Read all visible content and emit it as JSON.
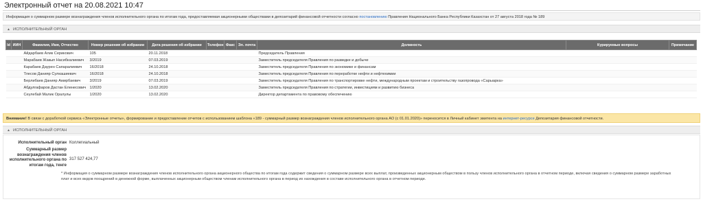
{
  "page": {
    "title": "Электронный отчет на 20.08.2021 10:47"
  },
  "info_bar": {
    "text_before": "Информация о суммарном размере вознаграждения членов исполнительного органа по итогам года, предоставляемая акционерными обществами в депозитарий финансовой отчетности согласно ",
    "link_text": "постановлению",
    "text_after": " Правления Национального Банка Республики Казахстан от 27 августа 2018 года № 189"
  },
  "section1": {
    "icon": "triangle-up-icon",
    "title": "ИСПОЛНИТЕЛЬНЫЙ ОРГАН"
  },
  "table": {
    "columns": [
      "Id",
      "ИИН",
      "Фамилия, Имя, Отчество",
      "Номер решения об избрании",
      "Дата решения об избрании",
      "Телефон",
      "Факс",
      "Эл. почта",
      "Должность",
      "Курируемые вопросы",
      "Примечание"
    ],
    "rows": [
      [
        "",
        "",
        "Айдарбаев Алик Серикович",
        "105",
        "20.11.2018",
        "",
        "",
        "",
        "Председатель Правления",
        "",
        ""
      ],
      [
        "",
        "",
        "Марабаев Жакып Насибкалиевич",
        "3/2019",
        "07.03.2019",
        "",
        "",
        "",
        "Заместитель председателя Правления по разведке и добыче",
        "",
        ""
      ],
      [
        "",
        "",
        "Карабаев Даурен Сапаралиевич",
        "16/2018",
        "24.10.2018",
        "",
        "",
        "",
        "Заместитель председателя Правления по экономике и финансам",
        "",
        ""
      ],
      [
        "",
        "",
        "Тлесов Данияр Сулкашиевич",
        "16/2018",
        "24.10.2018",
        "",
        "",
        "",
        "Заместитель председателя Правления по переработке нефти и нефтехимии",
        "",
        ""
      ],
      [
        "",
        "",
        "Берлибаев Данияр Амирбаевич",
        "3/2019",
        "07.03.2019",
        "",
        "",
        "",
        "Заместитель председателя Правления по транспортировке нефти, международным проектам и строительству газопровода «Сарыарка»",
        "",
        ""
      ],
      [
        "",
        "",
        "Абдулгафаров Дастан Еленесович",
        "1/2020",
        "13.02.2020",
        "",
        "",
        "",
        "Заместитель председателя Правления по стратегии, инвестициям и развитию бизнеса",
        "",
        ""
      ],
      [
        "",
        "",
        "Сеулебай Малик Оралулы",
        "1/2020",
        "13.02.2020",
        "",
        "",
        "",
        "Директор департамента по правовому обеспечению",
        "",
        ""
      ]
    ]
  },
  "warning": {
    "bold": "Внимание!",
    "text_before": " В связи с доработкой сервиса «Электронные отчеты», формирование и предоставление отчетов с использованием шаблона «189 - суммарный размер вознаграждения членов исполнительного органа АО (с 01.01.2020)» переносится в Личный кабинет эмитента на ",
    "link_text": "интернет-ресурсе",
    "text_after": " Депозитария финансовой отчетности."
  },
  "section2": {
    "icon": "triangle-up-icon",
    "title": "ИСПОЛНИТЕЛЬНЫЙ ОРГАН",
    "organ_label": "Исполнительный орган",
    "organ_value": "Коллегиальный",
    "amount_label": "Суммарный размер вознаграждения членов исполнительного органа по итогам года, тенге",
    "amount_value": "317 527 424,77",
    "note": "* Информация о суммарном размере вознаграждения членов исполнительного органа акционерного общества по итогам года содержит сведения о суммарном размере всех выплат, произведенных акционерным обществом в пользу членов исполнительного органа в отчетном периоде, включая сведения о суммарном размере заработных плат и всех видов поощрений в денежной форме, выплаченных акционерным обществом членам исполнительного органа в период их нахождения в составе исполнительного органа в отчетном периоде."
  }
}
